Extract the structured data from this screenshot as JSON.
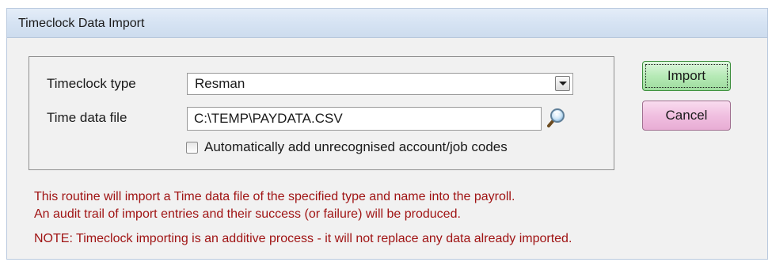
{
  "window": {
    "title": "Timeclock Data Import"
  },
  "form": {
    "timeclock_type_label": "Timeclock type",
    "timeclock_type_value": "Resman",
    "time_data_file_label": "Time data file",
    "time_data_file_value": "C:\\TEMP\\PAYDATA.CSV",
    "auto_add_label": "Automatically add unrecognised account/job codes",
    "auto_add_checked": false
  },
  "buttons": {
    "import_label": "Import",
    "cancel_label": "Cancel"
  },
  "messages": {
    "line1": "This routine will import a Time data file of the specified type and name into the payroll.",
    "line2": "An audit trail of import entries and their success (or failure) will be produced.",
    "note": "NOTE: Timeclock importing is an additive process - it will not replace any data already imported."
  },
  "colors": {
    "message_text": "#a01414",
    "import_button": "#b6eab6",
    "cancel_button": "#f0bfe0",
    "titlebar": "#d6e3f3"
  },
  "icons": {
    "browse": "magnifier-icon",
    "dropdown": "chevron-down-icon"
  }
}
